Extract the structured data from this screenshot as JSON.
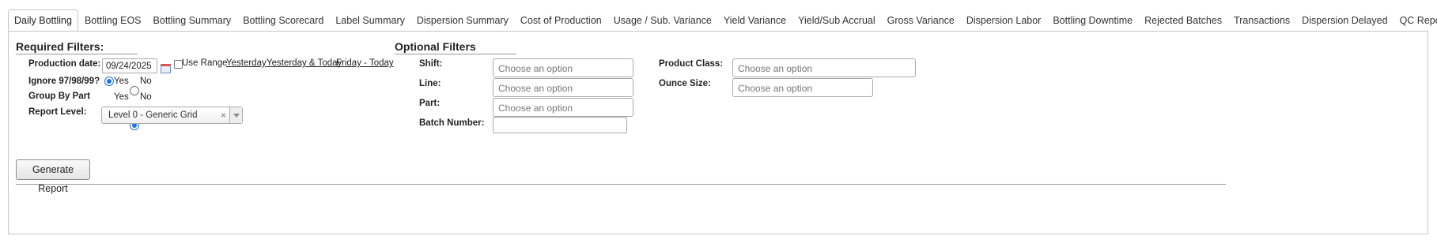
{
  "tabs": [
    {
      "label": "Daily Bottling",
      "active": true
    },
    {
      "label": "Bottling EOS"
    },
    {
      "label": "Bottling Summary"
    },
    {
      "label": "Bottling Scorecard"
    },
    {
      "label": "Label Summary"
    },
    {
      "label": "Dispersion Summary"
    },
    {
      "label": "Cost of Production"
    },
    {
      "label": "Usage / Sub. Variance"
    },
    {
      "label": "Yield Variance"
    },
    {
      "label": "Yield/Sub Accrual"
    },
    {
      "label": "Gross Variance"
    },
    {
      "label": "Dispersion Labor"
    },
    {
      "label": "Bottling Downtime"
    },
    {
      "label": "Rejected Batches"
    },
    {
      "label": "Transactions"
    },
    {
      "label": "Dispersion Delayed"
    },
    {
      "label": "QC Report"
    }
  ],
  "required": {
    "title": "Required Filters:",
    "production_date_label": "Production date:",
    "production_date_value": "09/24/2025",
    "use_range_label": "Use Range",
    "use_range_checked": false,
    "quick_links": [
      "Yesterday",
      "Yesterday & Today",
      "Friday - Today"
    ],
    "ignore_label": "Ignore 97/98/99?",
    "ignore_yes": "Yes",
    "ignore_no": "No",
    "ignore_selected": "Yes",
    "group_label": "Group By Part",
    "group_yes": "Yes",
    "group_no": "No",
    "group_selected": "No",
    "report_level_label": "Report Level:",
    "report_level_value": "Level 0 - Generic Grid",
    "clear_symbol": "×"
  },
  "optional": {
    "title": "Optional Filters",
    "shift_label": "Shift:",
    "line_label": "Line:",
    "part_label": "Part:",
    "batch_label": "Batch Number:",
    "product_class_label": "Product Class:",
    "ounce_size_label": "Ounce Size:",
    "placeholder": "Choose an option",
    "batch_value": ""
  },
  "actions": {
    "generate_label": "Generate Report"
  }
}
